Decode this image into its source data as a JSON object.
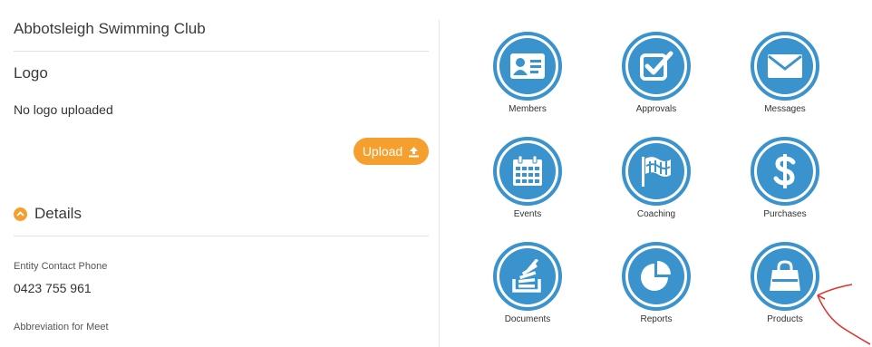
{
  "left": {
    "club_name": "Abbotsleigh Swimming Club",
    "logo_heading": "Logo",
    "no_logo_text": "No logo uploaded",
    "upload_label": "Upload",
    "details_label": "Details",
    "fields": [
      {
        "label": "Entity Contact Phone",
        "value": "0423 755 961"
      },
      {
        "label": "Abbreviation for Meet",
        "value": ""
      }
    ]
  },
  "tiles": [
    {
      "label": "Members",
      "icon": "member-card-icon"
    },
    {
      "label": "Approvals",
      "icon": "checkbox-icon"
    },
    {
      "label": "Messages",
      "icon": "envelope-icon"
    },
    {
      "label": "Events",
      "icon": "calendar-icon"
    },
    {
      "label": "Coaching",
      "icon": "flag-icon"
    },
    {
      "label": "Purchases",
      "icon": "dollar-icon"
    },
    {
      "label": "Documents",
      "icon": "stack-icon"
    },
    {
      "label": "Reports",
      "icon": "pie-chart-icon"
    },
    {
      "label": "Products",
      "icon": "shopping-bag-icon"
    }
  ],
  "colors": {
    "accent": "#f5a02e",
    "tile_blue": "#3a93cc",
    "annotation_red": "#e0322b"
  }
}
